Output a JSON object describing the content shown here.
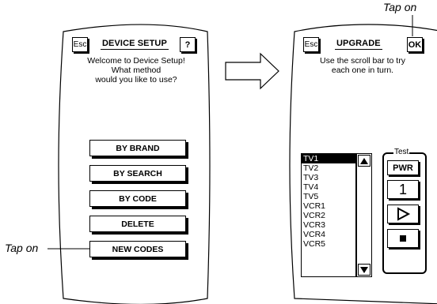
{
  "left_screen": {
    "esc_label": "Esc",
    "title": "DEVICE SETUP",
    "help_label": "?",
    "message_line1": "Welcome to Device Setup!",
    "message_line2": "What method",
    "message_line3": "would you like to use?",
    "buttons": [
      {
        "label": "BY BRAND"
      },
      {
        "label": "BY SEARCH"
      },
      {
        "label": "BY CODE"
      },
      {
        "label": "DELETE"
      },
      {
        "label": "NEW CODES"
      }
    ]
  },
  "right_screen": {
    "esc_label": "Esc",
    "title": "UPGRADE",
    "ok_label": "OK",
    "message_line1": "Use the scroll bar to try",
    "message_line2": "each one in turn.",
    "list_items": [
      "TV1",
      "TV2",
      "TV3",
      "TV4",
      "TV5",
      "VCR1",
      "VCR2",
      "VCR3",
      "VCR4",
      "VCR5"
    ],
    "selected_index": 0,
    "test_label": "Test",
    "test_buttons": {
      "power_label": "PWR",
      "channel_label": "1",
      "play_icon": "play-icon",
      "stop_icon": "stop-icon"
    },
    "scroll_up_icon": "scroll-up-icon",
    "scroll_down_icon": "scroll-down-icon"
  },
  "annotations": {
    "tap_on_left": "Tap on",
    "tap_on_right": "Tap on"
  },
  "arrow_icon": "right-arrow-icon"
}
